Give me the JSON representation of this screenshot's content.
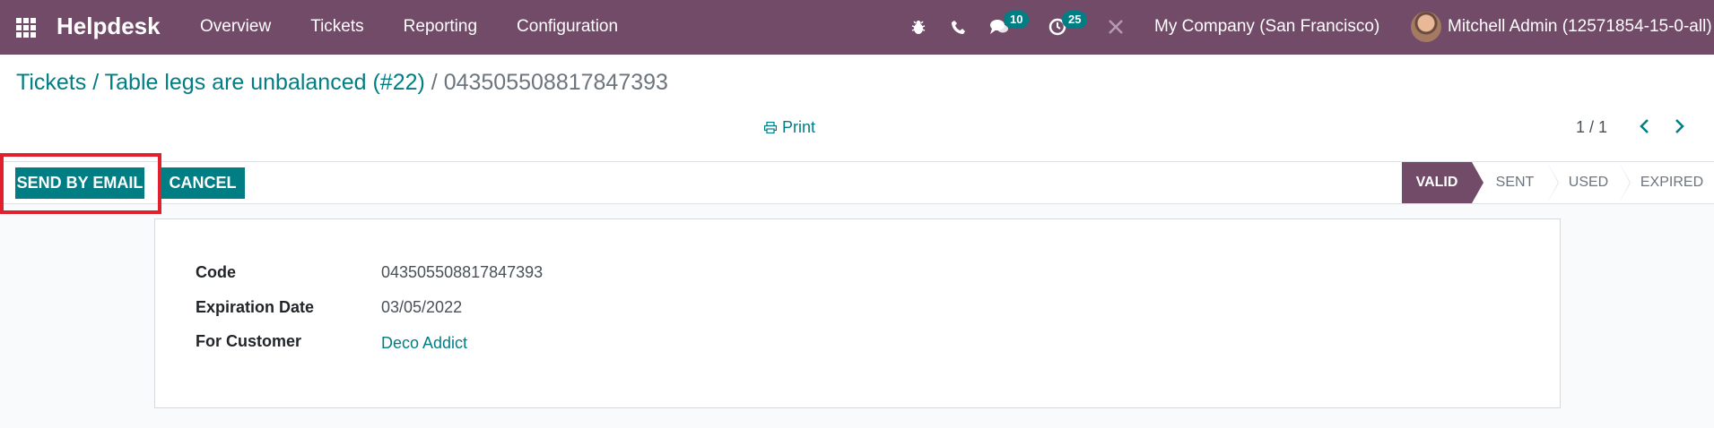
{
  "navbar": {
    "brand": "Helpdesk",
    "menu": [
      "Overview",
      "Tickets",
      "Reporting",
      "Configuration"
    ],
    "messages_count": "10",
    "activities_count": "25",
    "company": "My Company (San Francisco)",
    "user": "Mitchell Admin (12571854-15-0-all)"
  },
  "breadcrumb": {
    "root": "Tickets",
    "sep1": " / ",
    "ticket": "Table legs are unbalanced (#22)",
    "sep2": " / ",
    "current": "043505508817847393"
  },
  "toolbar": {
    "print_label": "Print",
    "pager": "1 / 1"
  },
  "statusbar": {
    "send_email_label": "SEND BY EMAIL",
    "cancel_label": "CANCEL",
    "stages": [
      "VALID",
      "SENT",
      "USED",
      "EXPIRED"
    ],
    "active_stage": "VALID"
  },
  "form": {
    "code_label": "Code",
    "code_value": "043505508817847393",
    "expiration_label": "Expiration Date",
    "expiration_value": "03/05/2022",
    "customer_label": "For Customer",
    "customer_value": "Deco Addict"
  },
  "colors": {
    "brand": "#714b67",
    "accent": "#017e84",
    "highlight": "#e0212d"
  }
}
